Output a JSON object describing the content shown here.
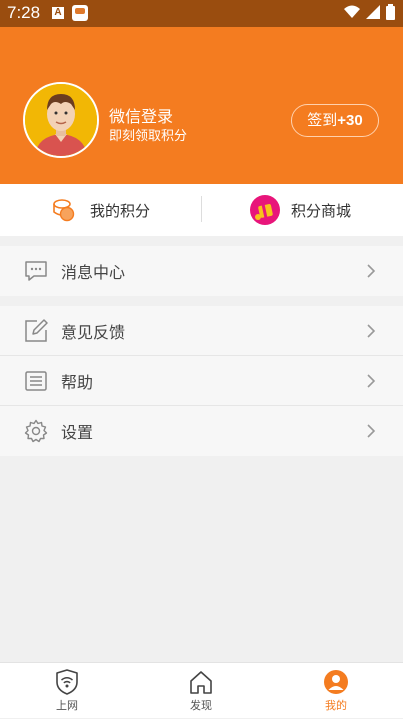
{
  "status_bar": {
    "time": "7:28",
    "a_icon_text": "A"
  },
  "header": {
    "user_name": "微信登录",
    "user_subtitle": "即刻领取积分",
    "checkin_label": "签到",
    "checkin_bonus": "+30",
    "accent_color": "#f47c20"
  },
  "points_bar": {
    "my_points_label": "我的积分",
    "points_mall_label": "积分商城"
  },
  "menu": {
    "messages": "消息中心",
    "feedback": "意见反馈",
    "help": "帮助",
    "settings": "设置"
  },
  "bottom_nav": {
    "items": [
      {
        "label": "上网",
        "icon": "wifi-shield-icon",
        "active": false
      },
      {
        "label": "发现",
        "icon": "home-icon",
        "active": false
      },
      {
        "label": "我的",
        "icon": "person-icon",
        "active": true
      }
    ]
  }
}
